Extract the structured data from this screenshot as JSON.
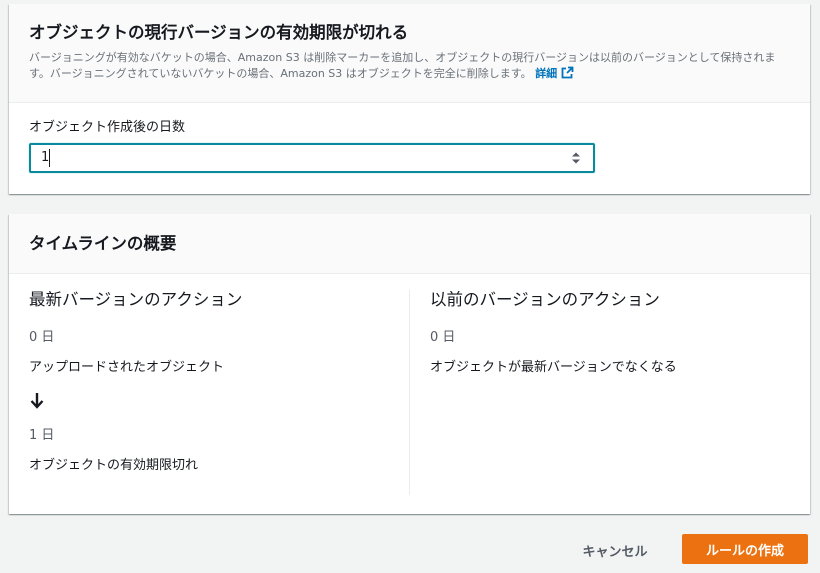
{
  "expiration": {
    "title": "オブジェクトの現行バージョンの有効期限が切れる",
    "description": "バージョニングが有効なバケットの場合、Amazon S3 は削除マーカーを追加し、オブジェクトの現行バージョンは以前のバージョンとして保持されます。バージョニングされていないバケットの場合、Amazon S3 はオブジェクトを完全に削除します。",
    "info_link": "詳細",
    "days_label": "オブジェクト作成後の日数",
    "days_value": "1"
  },
  "timeline": {
    "title": "タイムラインの概要",
    "current": {
      "title": "最新バージョンのアクション",
      "events": [
        {
          "day": "0 日",
          "text": "アップロードされたオブジェクト"
        },
        {
          "day": "1 日",
          "text": "オブジェクトの有効期限切れ"
        }
      ]
    },
    "previous": {
      "title": "以前のバージョンのアクション",
      "events": [
        {
          "day": "0 日",
          "text": "オブジェクトが最新バージョンでなくなる"
        }
      ]
    }
  },
  "footer": {
    "cancel_label": "キャンセル",
    "create_label": "ルールの作成"
  },
  "icons": {
    "external_link": "external-link-icon",
    "arrow_down": "arrow-down-icon",
    "spinner": "spinner-icon"
  },
  "colors": {
    "primary": "#ec7211",
    "link": "#0073bb",
    "focus": "#0a8a9f"
  }
}
